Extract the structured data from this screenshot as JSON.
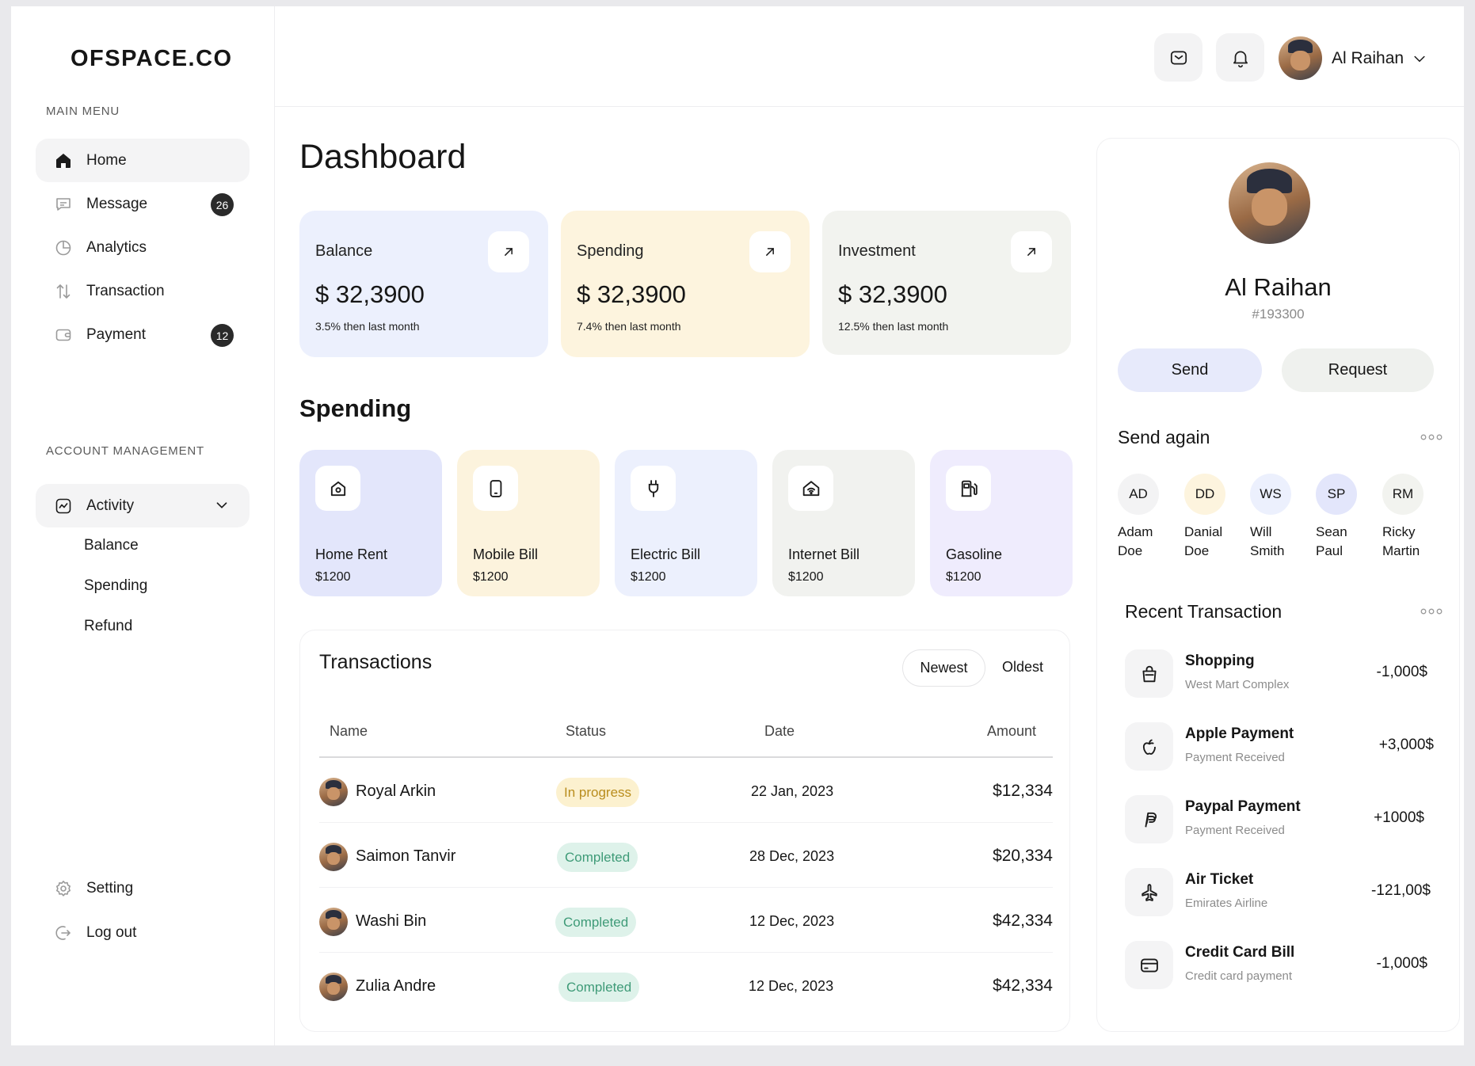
{
  "brand": "OFSPACE.CO",
  "sidebar": {
    "main_menu_label": "MAIN MENU",
    "main_items": [
      {
        "label": "Home",
        "icon": "home-icon",
        "badge": ""
      },
      {
        "label": "Message",
        "icon": "message-icon",
        "badge": "26"
      },
      {
        "label": "Analytics",
        "icon": "analytics-icon",
        "badge": ""
      },
      {
        "label": "Transaction",
        "icon": "transaction-icon",
        "badge": ""
      },
      {
        "label": "Payment",
        "icon": "wallet-icon",
        "badge": "12"
      }
    ],
    "account_label": "ACCOUNT MANAGEMENT",
    "activity": {
      "label": "Activity",
      "icon": "activity-icon"
    },
    "sub_items": [
      "Balance",
      "Spending",
      "Refund"
    ],
    "setting_label": "Setting",
    "logout_label": "Log out"
  },
  "header": {
    "user_name": "Al Raihan"
  },
  "main": {
    "title": "Dashboard",
    "cards": [
      {
        "label": "Balance",
        "value": "$ 32,3900",
        "note": "3.5% then last month",
        "color": "#ecf0fd"
      },
      {
        "label": "Spending",
        "value": "$ 32,3900",
        "note": "7.4% then last month",
        "color": "#fdf4de"
      },
      {
        "label": "Investment",
        "value": "$ 32,3900",
        "note": "12.5% then last month",
        "color": "#f2f3ef"
      }
    ],
    "spending_title": "Spending",
    "spending": [
      {
        "name": "Home Rent",
        "amount": "$1200",
        "icon": "home-outline-icon",
        "color": "#e3e6fb"
      },
      {
        "name": "Mobile Bill",
        "amount": "$1200",
        "icon": "phone-icon",
        "color": "#fcf3dd"
      },
      {
        "name": "Electric Bill",
        "amount": "$1200",
        "icon": "plug-icon",
        "color": "#ecf0fd"
      },
      {
        "name": "Internet Bill",
        "amount": "$1200",
        "icon": "wifi-home-icon",
        "color": "#f1f2ef"
      },
      {
        "name": "Gasoline",
        "amount": "$1200",
        "icon": "gas-station-icon",
        "color": "#efecfd"
      }
    ],
    "transactions": {
      "title": "Transactions",
      "tab_newest": "Newest",
      "tab_oldest": "Oldest",
      "columns": [
        "Name",
        "Status",
        "Date",
        "Amount"
      ],
      "rows": [
        {
          "name": "Royal Arkin",
          "status": "In progress",
          "date": "22 Jan, 2023",
          "amount": "$12,334"
        },
        {
          "name": "Saimon Tanvir",
          "status": "Completed",
          "date": "28 Dec, 2023",
          "amount": "$20,334"
        },
        {
          "name": "Washi Bin",
          "status": "Completed",
          "date": "12 Dec, 2023",
          "amount": "$42,334"
        },
        {
          "name": "Zulia Andre",
          "status": "Completed",
          "date": "12 Dec, 2023",
          "amount": "$42,334"
        }
      ]
    }
  },
  "profile": {
    "name": "Al Raihan",
    "id": "#193300",
    "send_label": "Send",
    "request_label": "Request",
    "send_again_title": "Send again",
    "contacts": [
      {
        "initials": "AD",
        "first": "Adam",
        "last": "Doe",
        "color": "#f3f3f4"
      },
      {
        "initials": "DD",
        "first": "Danial",
        "last": "Doe",
        "color": "#fdf4de"
      },
      {
        "initials": "WS",
        "first": "Will",
        "last": "Smith",
        "color": "#ecf0fd"
      },
      {
        "initials": "SP",
        "first": "Sean",
        "last": "Paul",
        "color": "#e3e6fb"
      },
      {
        "initials": "RM",
        "first": "Ricky",
        "last": "Martin",
        "color": "#f2f3ef"
      }
    ],
    "recent_title": "Recent Transaction",
    "recent": [
      {
        "name": "Shopping",
        "sub": "West Mart Complex",
        "amount": "-1,000$",
        "icon": "shopping-bag-icon"
      },
      {
        "name": "Apple Payment",
        "sub": "Payment Received",
        "amount": "+3,000$",
        "icon": "apple-icon"
      },
      {
        "name": "Paypal Payment",
        "sub": "Payment Received",
        "amount": "+1000$",
        "icon": "paypal-icon"
      },
      {
        "name": "Air Ticket",
        "sub": "Emirates Airline",
        "amount": "-121,00$",
        "icon": "airplane-icon"
      },
      {
        "name": "Credit Card Bill",
        "sub": "Credit card payment",
        "amount": "-1,000$",
        "icon": "credit-card-icon"
      }
    ]
  }
}
